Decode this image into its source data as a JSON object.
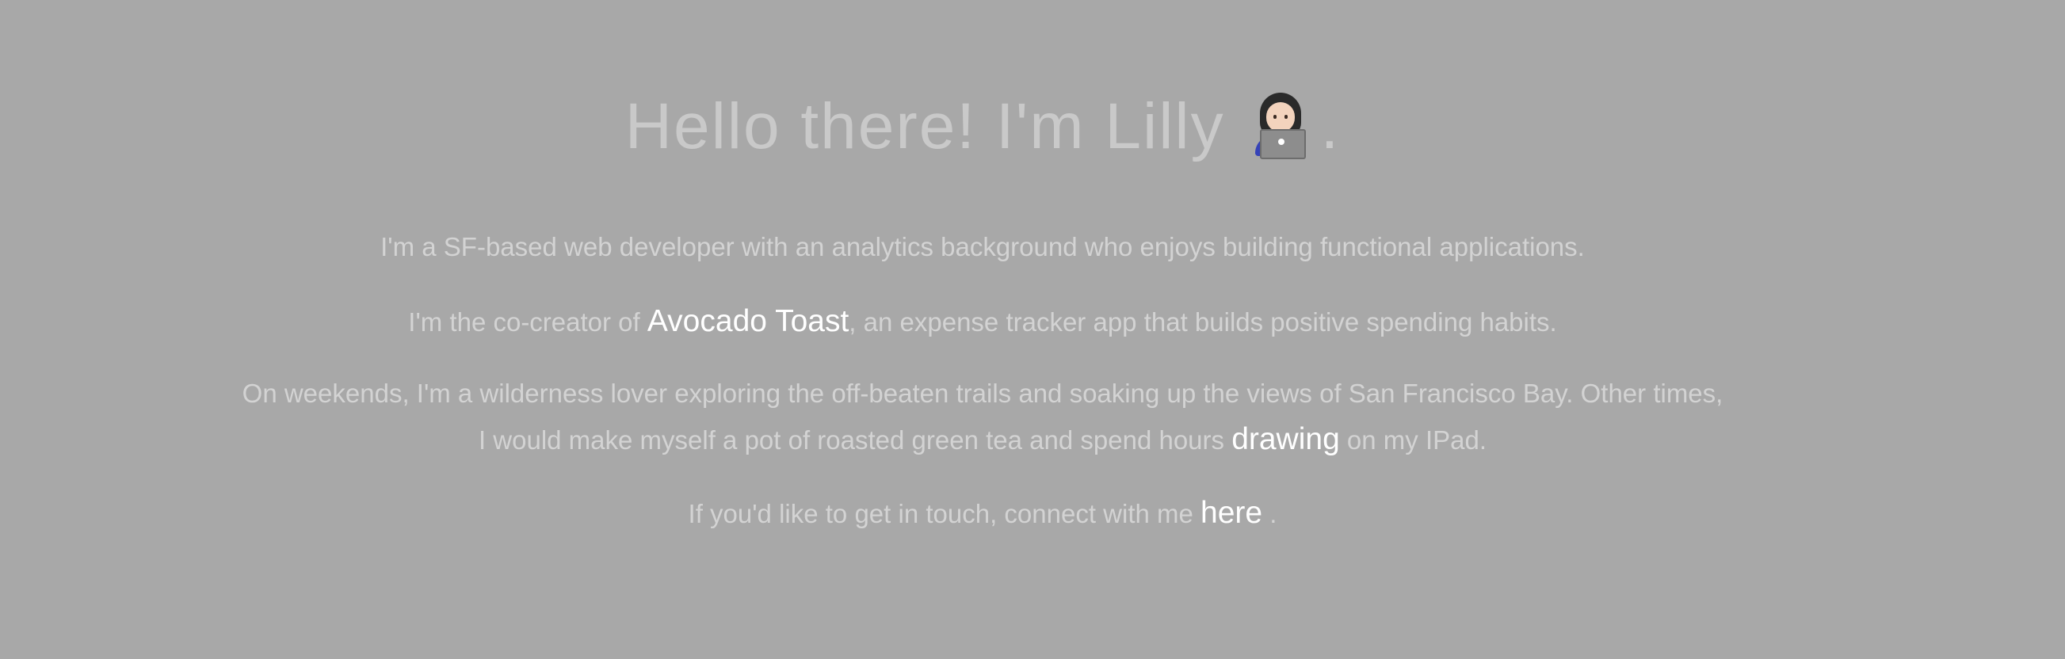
{
  "heading": {
    "text": "Hello there! I'm Lilly",
    "emoji": "woman-technologist-icon",
    "suffix": "."
  },
  "paragraphs": {
    "p1": "I'm a SF-based web developer with an analytics background who enjoys building functional applications.",
    "p2_before": "I'm the co-creator of ",
    "p2_link": "Avocado Toast",
    "p2_after": ", an expense tracker app that builds positive spending habits.",
    "p3_line1": "On weekends, I'm a wilderness lover exploring the off-beaten trails and soaking up the views of San Francisco Bay. Other times,",
    "p3_line2_before": "I would make myself a pot of roasted green tea and spend hours ",
    "p3_link": "drawing",
    "p3_line2_after": " on my IPad.",
    "p4_before": "If you'd like to get in touch, connect with me ",
    "p4_link": "here",
    "p4_after": " ."
  },
  "colors": {
    "background": "#a8a8a8",
    "text": "#d3d3d3",
    "link": "#ffffff"
  }
}
